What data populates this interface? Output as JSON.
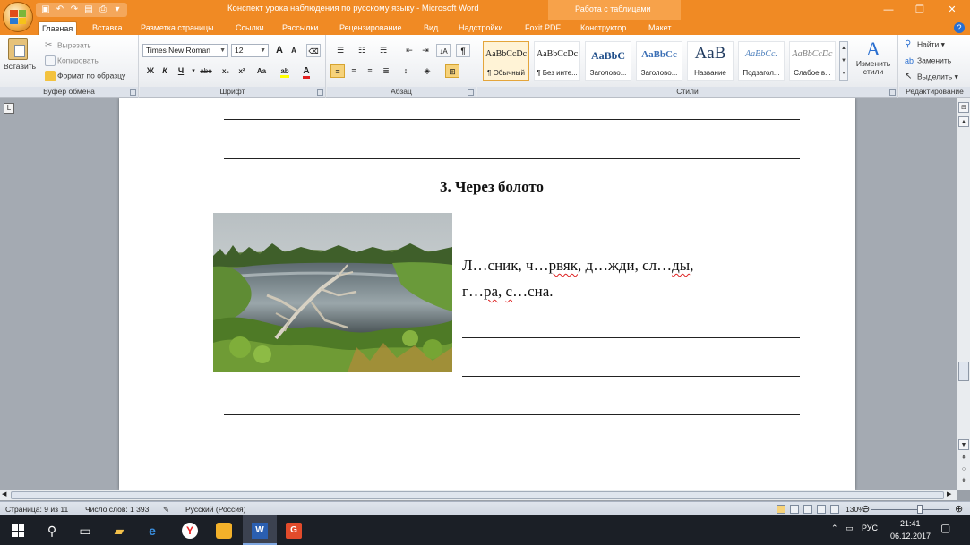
{
  "window": {
    "title": "Конспект урока наблюдения по русскому языку - Microsoft Word",
    "context_tab_title": "Работа с таблицами",
    "minimize": "—",
    "maximize": "❐",
    "close": "✕"
  },
  "tabs": [
    {
      "label": "Главная"
    },
    {
      "label": "Вставка"
    },
    {
      "label": "Разметка страницы"
    },
    {
      "label": "Ссылки"
    },
    {
      "label": "Рассылки"
    },
    {
      "label": "Рецензирование"
    },
    {
      "label": "Вид"
    },
    {
      "label": "Надстройки"
    },
    {
      "label": "Foxit PDF"
    },
    {
      "label": "Конструктор"
    },
    {
      "label": "Макет"
    }
  ],
  "clipboard": {
    "paste": "Вставить",
    "cut": "Вырезать",
    "copy": "Копировать",
    "format_painter": "Формат по образцу",
    "label": "Буфер обмена"
  },
  "font": {
    "name": "Times New Roman",
    "size": "12",
    "label": "Шрифт",
    "bold": "Ж",
    "italic": "К",
    "underline": "Ч",
    "strike": "abe",
    "subscript": "x₂",
    "superscript": "x²",
    "case": "Aa",
    "grow": "A",
    "shrink": "A",
    "highlight_color": "#ffff00",
    "font_color": "#e02020"
  },
  "paragraph": {
    "label": "Абзац"
  },
  "styles": {
    "label": "Стили",
    "items": [
      {
        "sample": "AaBbCcDc",
        "name": "¶ Обычный"
      },
      {
        "sample": "AaBbCcDc",
        "name": "¶ Без инте..."
      },
      {
        "sample": "AaBbC",
        "name": "Заголово..."
      },
      {
        "sample": "AaBbCc",
        "name": "Заголово..."
      },
      {
        "sample": "AaB",
        "name": "Название"
      },
      {
        "sample": "AaBbCc.",
        "name": "Подзагол..."
      },
      {
        "sample": "AaBbCcDc",
        "name": "Слабое в..."
      }
    ],
    "change_styles": "Изменить стили"
  },
  "editing": {
    "label": "Редактирование",
    "find": "Найти",
    "replace": "Заменить",
    "select": "Выделить"
  },
  "document": {
    "heading": "3. Через болото",
    "line1": [
      {
        "t": "Л…сник, ч…",
        "sq": false
      },
      {
        "t": "рвяк",
        "sq": true
      },
      {
        "t": ", д…жди, сл…",
        "sq": false
      },
      {
        "t": "ды",
        "sq": true
      },
      {
        "t": ",",
        "sq": false
      }
    ],
    "line2": [
      {
        "t": "г…",
        "sq": false
      },
      {
        "t": "ра",
        "sq": true
      },
      {
        "t": ", ",
        "sq": false
      },
      {
        "t": "с",
        "sq": true
      },
      {
        "t": "…сна.",
        "sq": false
      }
    ]
  },
  "status": {
    "page": "Страница: 9 из 11",
    "words": "Число слов: 1 393",
    "language": "Русский (Россия)",
    "zoom": "130%"
  },
  "taskbar": {
    "language": "РУС",
    "time": "21:41",
    "date": "06.12.2017"
  }
}
